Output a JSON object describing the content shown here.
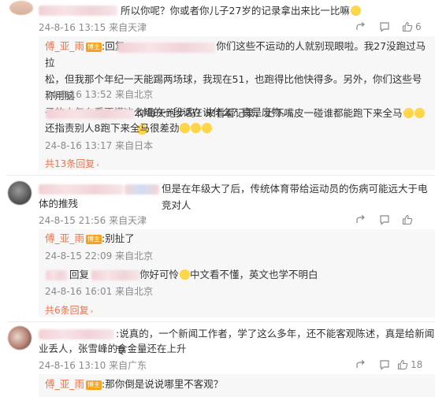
{
  "comments": [
    {
      "text_tail": "所以你呢？你或者你儿子27岁的记录拿出来比一比嘛",
      "time": "24-8-16 13:15",
      "loc": "来自天津",
      "likes": "6",
      "replies": [
        {
          "user": "傅_亚_雨",
          "badge": "博主",
          "text": ":回复",
          "text2": "你们这些不运动的人就别现眼啦。我27没跑过马拉",
          "line2": "松，但我那个年纪一天能踢两场球，我现在51，也跑得比他快得多。另外，你们这些号称用脑",
          "line3": "子的人怎么看不懂这么短的一段话在说什么？真是废物。",
          "time": "24-8-16 13:52",
          "loc": "来自北京"
        },
        {
          "text": "你每天跑步吗？来看看记录，上下嘴皮一碰谁都能跑下来全马",
          "line2": "还指责别人8跑下来全马很差劲",
          "time": "24-8-16 13:17",
          "loc": "来自日本"
        }
      ],
      "more": "共13条回复"
    },
    {
      "text_tail": "但是在年级大了后，传统体育带给运动员的伤病可能远大于电竞对人",
      "line2": "体的推残",
      "time": "24-8-15 21:56",
      "loc": "来自天津",
      "replies": [
        {
          "user": "傅_亚_雨",
          "badge": "博主",
          "text": ":别扯了",
          "time": "24-8-15 22:09",
          "loc": "来自北京"
        },
        {
          "text_a": "回复",
          "text_b": "你好可怜",
          "text_c": "中文看不懂，英文也学不明白",
          "time": "24-8-16 16:01",
          "loc": "来自北京"
        }
      ],
      "more": "共6条回复"
    },
    {
      "text_tail": ":说真的，一个新闻工作者，学了这么多年，还不能客观陈述，真是给新闻专",
      "line2": "业丢人，张雪峰的含金量还在上升",
      "time": "24-8-16 13:10",
      "loc": "来自广东",
      "likes": "18",
      "replies": [
        {
          "user": "傅_亚_雨",
          "badge": "博主",
          "text": ":那你倒是说说哪里不客观？"
        }
      ]
    }
  ]
}
